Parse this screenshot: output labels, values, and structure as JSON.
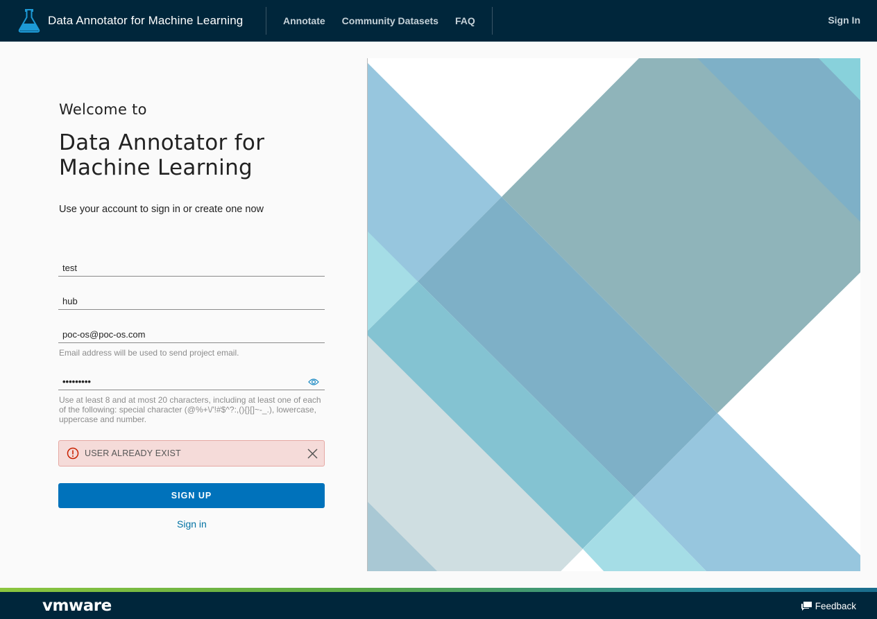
{
  "header": {
    "brand_title": "Data Annotator for Machine Learning",
    "nav": [
      "Annotate",
      "Community Datasets",
      "FAQ"
    ],
    "sign_in": "Sign In"
  },
  "form": {
    "welcome": "Welcome to",
    "app_title": "Data Annotator for Machine Learning",
    "subtitle": "Use your account to sign in or create one now",
    "first_name": "test",
    "last_name": "hub",
    "email": "poc-os@poc-os.com",
    "email_hint": "Email address will be used to send project email.",
    "password": "•••••••••",
    "password_hint": "Use at least 8 and at most 20 characters, including at least one of each of the following: special character (@%+\\/'!#$^?:,(){}[]~-_.), lowercase, uppercase and number.",
    "alert": "USER ALREADY EXIST",
    "signup_button": "SIGN UP",
    "signin_link": "Sign in"
  },
  "footer": {
    "logo": "vmware",
    "feedback": "Feedback"
  },
  "colors": {
    "header_bg": "#00263b",
    "primary": "#0072bb",
    "alert_bg": "#f5dbd9"
  }
}
